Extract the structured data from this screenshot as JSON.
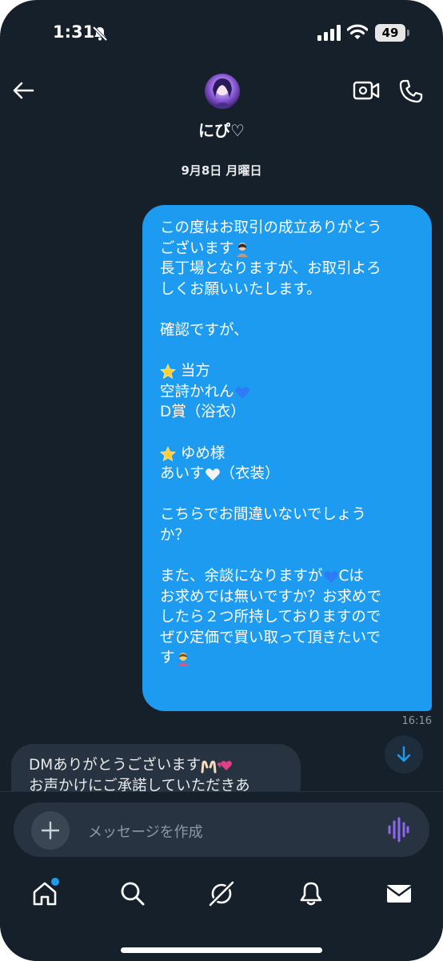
{
  "status_bar": {
    "time": "1:31",
    "battery": "49"
  },
  "header": {
    "name": "にぴ♡",
    "avatar_icon": "avatar-image",
    "back_icon": "arrow-left-icon",
    "video_icon": "video-call-icon",
    "call_icon": "phone-icon"
  },
  "conversation": {
    "date_divider": "9月8日 月曜日",
    "outgoing": {
      "lines": [
        "この度はお取引の成立ありがとう",
        "ございます",
        "長丁場となりますが、お取引よろ",
        "しくお願いいたします。",
        "",
        "確認ですが、",
        "",
        " 当方",
        "空詩かれん",
        "D賞（浴衣）",
        "",
        " ゆめ様",
        "あいす（衣装）",
        "",
        "こちらでお間違いないでしょう",
        "か？",
        "",
        "また、余談になりますが Cは",
        "お求めでは無いですか？お求めで",
        "したら２つ所持しておりますので",
        "ぜひ定価で買い取って頂きたいで",
        "す"
      ],
      "time": "16:16"
    },
    "incoming": {
      "lines": [
        "DMありがとうございます",
        "お声かけにご承諾していただきあ"
      ]
    }
  },
  "composer": {
    "placeholder": "メッセージを作成",
    "plus_icon": "plus-icon",
    "voice_icon": "voice-wave-icon"
  },
  "tab_bar": [
    "home-icon",
    "search-icon",
    "grok-icon",
    "bell-icon",
    "mail-icon"
  ],
  "colors": {
    "background": "#15202b",
    "accent": "#1d9bf0",
    "incoming_bubble": "#273340"
  }
}
